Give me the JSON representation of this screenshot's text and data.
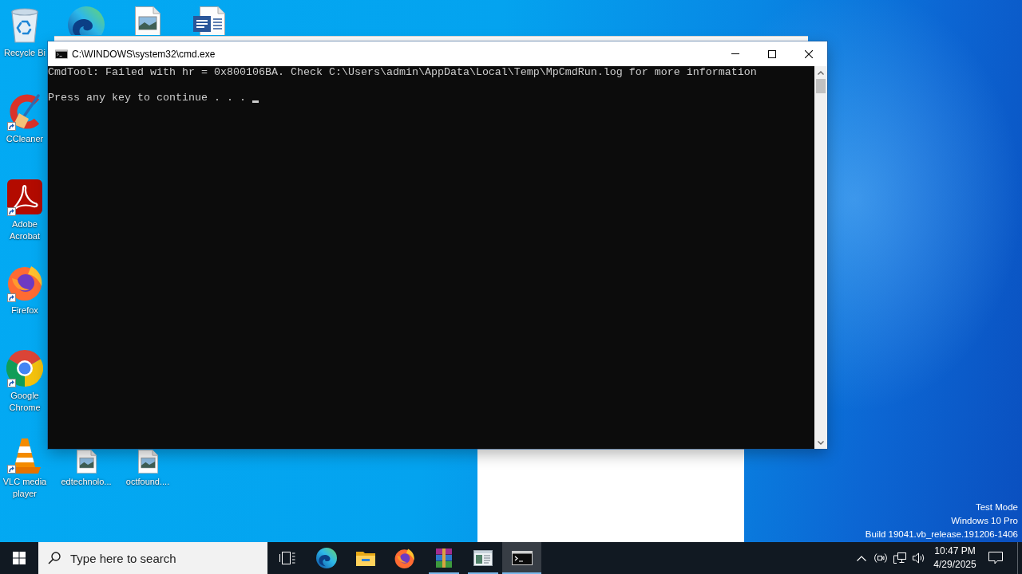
{
  "desktop": {
    "icons": [
      {
        "kind": "recycle-bin",
        "label": "Recycle Bi",
        "shortcut": false
      },
      {
        "kind": "edge",
        "shortcut": false
      },
      {
        "kind": "image-file",
        "shortcut": false
      },
      {
        "kind": "word-document",
        "shortcut": false
      },
      {
        "kind": "ccleaner",
        "label": "CCleaner",
        "shortcut": true
      },
      {
        "kind": "acrobat",
        "label": "Adobe Acrobat",
        "shortcut": true
      },
      {
        "kind": "firefox",
        "label": "Firefox",
        "shortcut": true
      },
      {
        "kind": "chrome",
        "label": "Google Chrome",
        "shortcut": true
      },
      {
        "kind": "vlc",
        "label": "VLC media player",
        "shortcut": true
      },
      {
        "kind": "image-file",
        "label": "edtechnolo...",
        "shortcut": false
      },
      {
        "kind": "image-file",
        "label": "octfound....",
        "shortcut": false
      }
    ],
    "system_info": [
      "Test Mode",
      "Windows 10 Pro",
      "Build 19041.vb_release.191206-1406"
    ]
  },
  "cmd_window": {
    "title": "C:\\WINDOWS\\system32\\cmd.exe",
    "lines": [
      "CmdTool: Failed with hr = 0x800106BA. Check C:\\Users\\admin\\AppData\\Local\\Temp\\MpCmdRun.log for more information",
      "Press any key to continue . . . "
    ]
  },
  "taskbar": {
    "search": {
      "placeholder": "Type here to search"
    },
    "apps": [
      {
        "kind": "edge",
        "running": false,
        "selected": false
      },
      {
        "kind": "explorer",
        "running": false,
        "selected": false
      },
      {
        "kind": "firefox",
        "running": false,
        "selected": false
      },
      {
        "kind": "winrar",
        "running": true,
        "selected": false
      },
      {
        "kind": "window-app",
        "running": true,
        "selected": false
      },
      {
        "kind": "cmd",
        "running": true,
        "selected": true
      }
    ],
    "clock": {
      "time": "10:47 PM",
      "date": "4/29/2025"
    }
  }
}
